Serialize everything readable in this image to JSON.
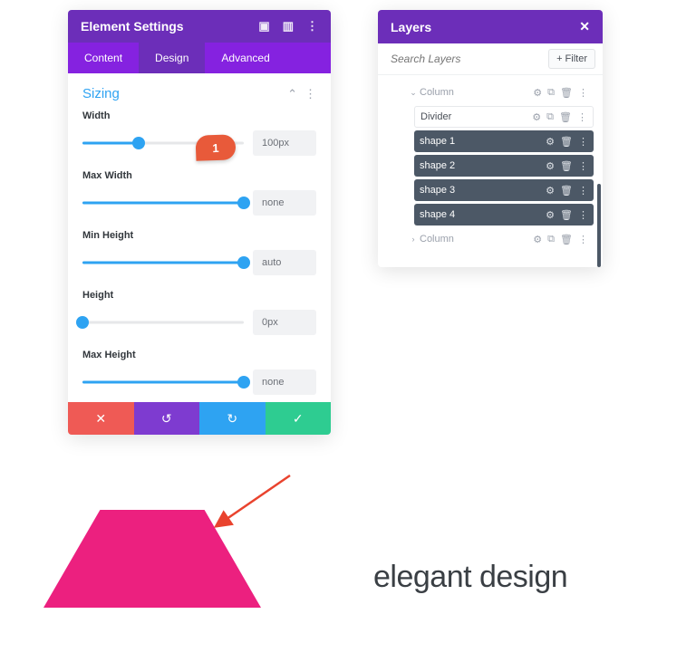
{
  "settings": {
    "title": "Element Settings",
    "tabs": {
      "content": "Content",
      "design": "Design",
      "advanced": "Advanced"
    },
    "section_title": "Sizing",
    "fields": {
      "width": {
        "label": "Width",
        "value": "100px",
        "pos": 35
      },
      "max_width": {
        "label": "Max Width",
        "value": "none",
        "pos": 100
      },
      "min_height": {
        "label": "Min Height",
        "value": "auto",
        "pos": 100
      },
      "height": {
        "label": "Height",
        "value": "0px",
        "pos": 0
      },
      "max_height": {
        "label": "Max Height",
        "value": "none",
        "pos": 100
      }
    },
    "callout": "1"
  },
  "layers": {
    "title": "Layers",
    "search_placeholder": "Search Layers",
    "filter_label": "Filter",
    "items": {
      "column_top": "Column",
      "divider": "Divider",
      "shape1": "shape 1",
      "shape2": "shape 2",
      "shape3": "shape 3",
      "shape4": "shape 4",
      "column_bottom": "Column"
    }
  },
  "footer_text": "elegant design"
}
